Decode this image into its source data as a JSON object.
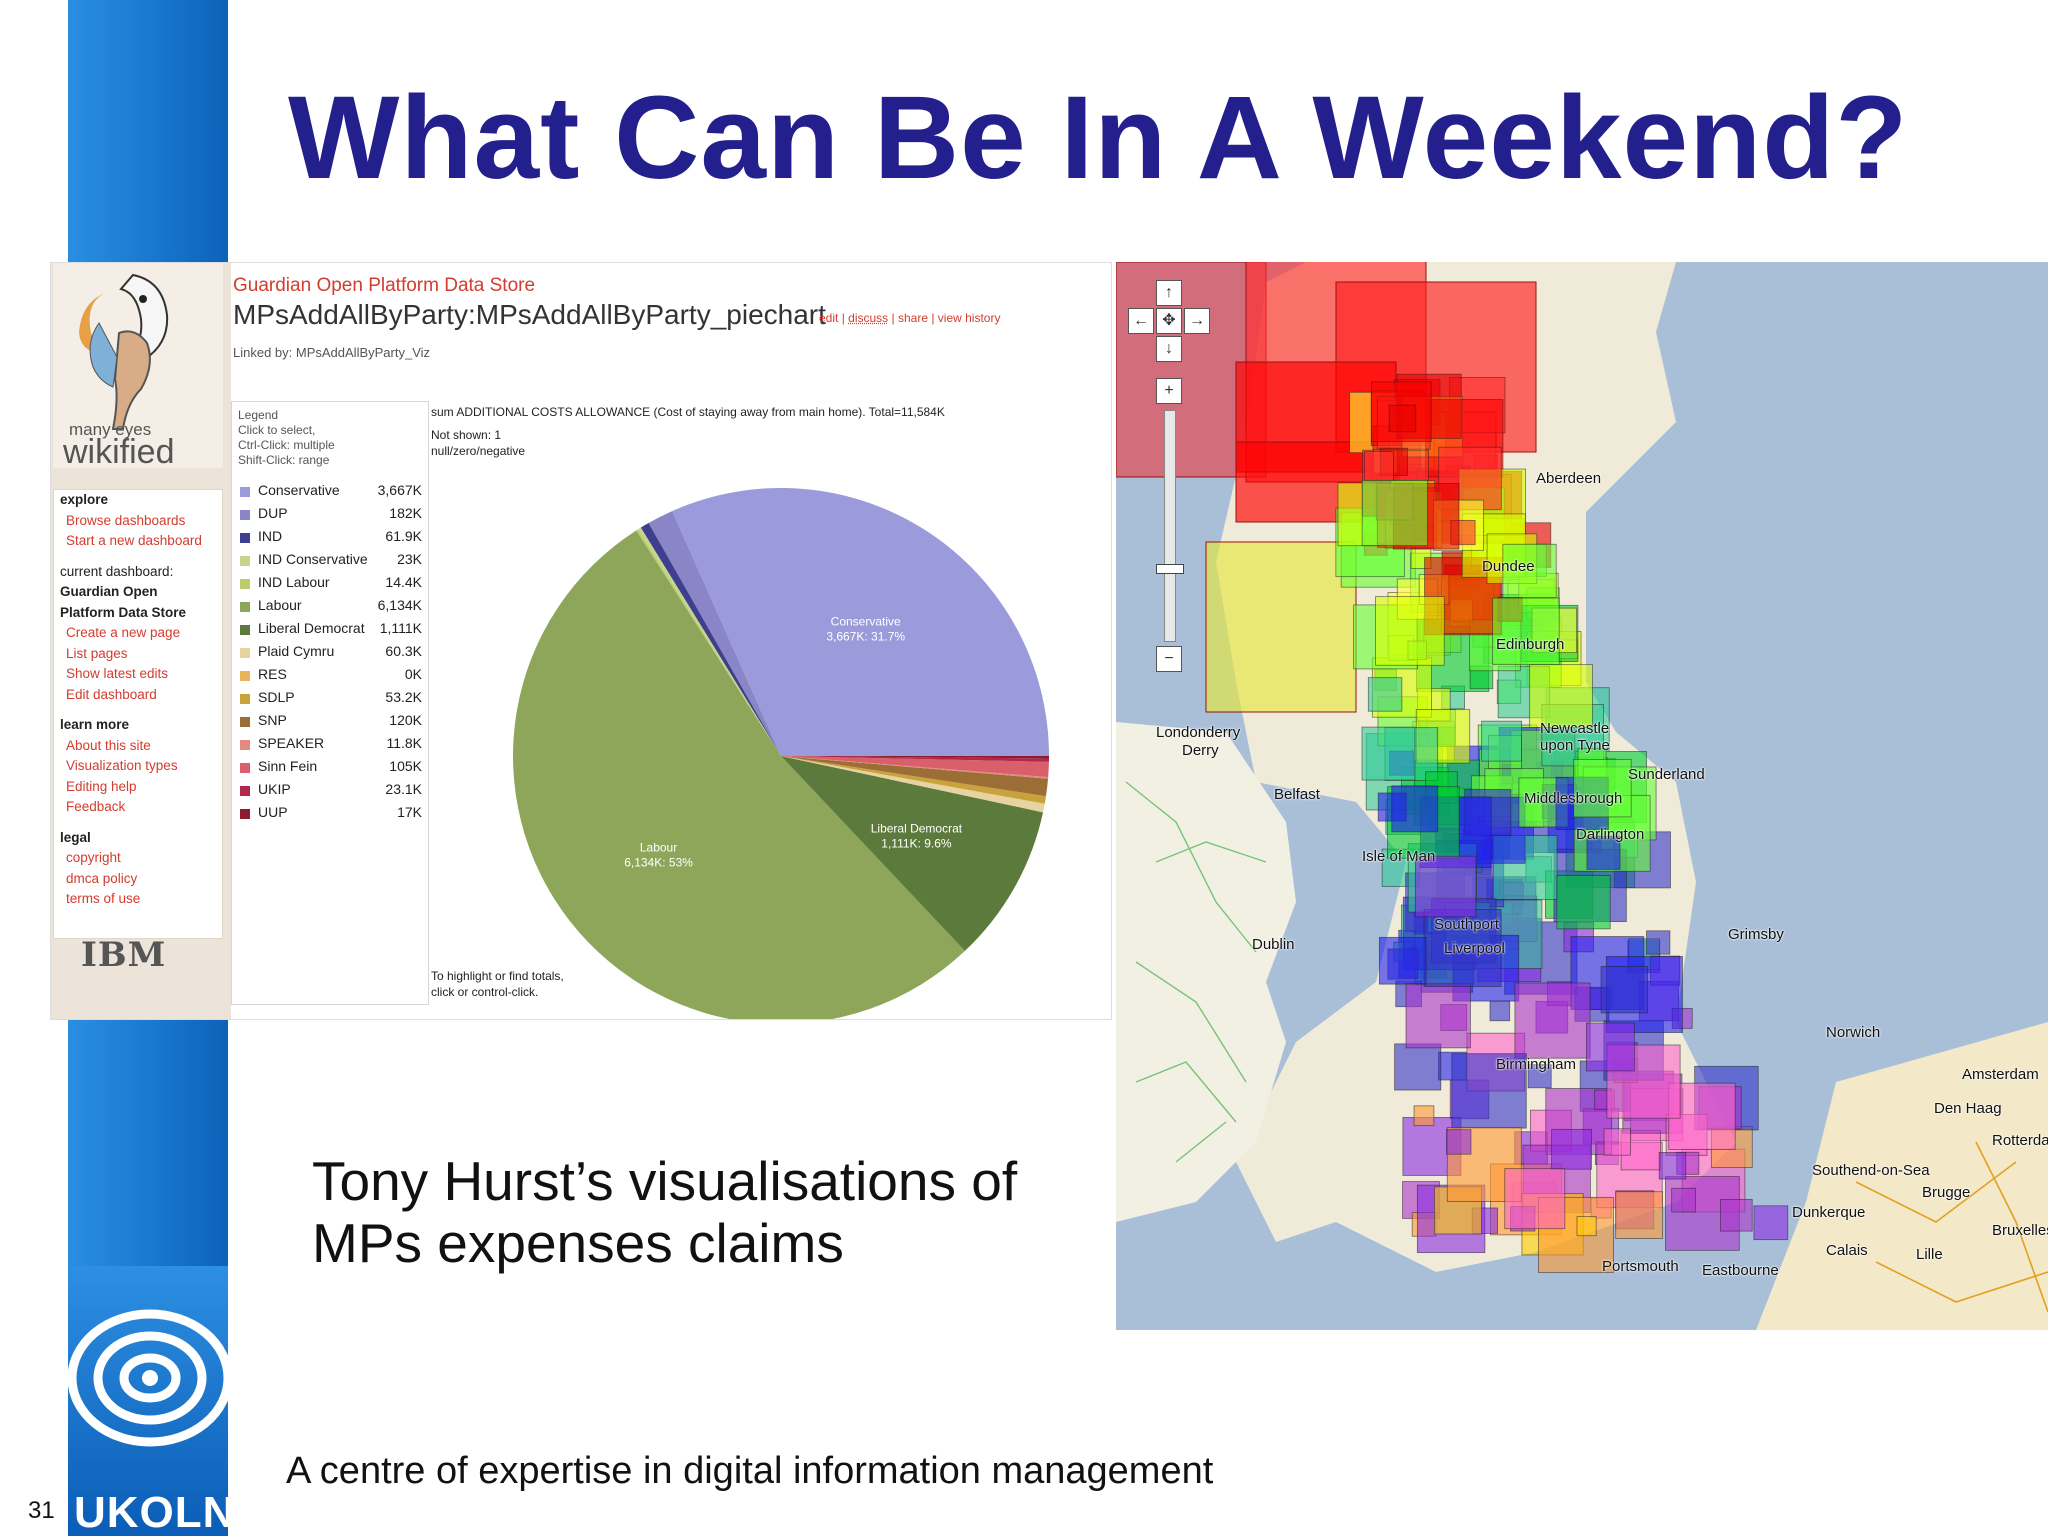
{
  "slide": {
    "title": "What Can Be In A Weekend?",
    "caption": "Tony Hurst’s visualisations of\nMPs expenses claims",
    "footer": "A centre of expertise in digital information management",
    "number": "31",
    "logo_text": "UKOLN"
  },
  "colors": {
    "title": "#231f8c",
    "bar": "#1877cf",
    "link": "#d33c2e"
  },
  "many_eyes": {
    "logo_line1": "many eyes",
    "logo_line2": "wikified",
    "menu": [
      {
        "kind": "h",
        "text": "explore"
      },
      {
        "kind": "l",
        "text": "Browse dashboards"
      },
      {
        "kind": "l",
        "text": "Start a new dashboard"
      },
      {
        "kind": "gap",
        "text": ""
      },
      {
        "kind": "t",
        "text": "current dashboard:"
      },
      {
        "kind": "h",
        "text": "Guardian Open"
      },
      {
        "kind": "h",
        "text": "Platform Data Store"
      },
      {
        "kind": "l",
        "text": "Create a new page"
      },
      {
        "kind": "l",
        "text": "List pages"
      },
      {
        "kind": "l",
        "text": "Show latest edits"
      },
      {
        "kind": "l",
        "text": "Edit dashboard"
      },
      {
        "kind": "gap",
        "text": ""
      },
      {
        "kind": "h",
        "text": "learn more"
      },
      {
        "kind": "l",
        "text": "About this site"
      },
      {
        "kind": "l",
        "text": "Visualization types"
      },
      {
        "kind": "l",
        "text": "Editing help"
      },
      {
        "kind": "l",
        "text": "Feedback"
      },
      {
        "kind": "gap",
        "text": ""
      },
      {
        "kind": "h",
        "text": "legal"
      },
      {
        "kind": "l",
        "text": "copyright"
      },
      {
        "kind": "l",
        "text": "dmca policy"
      },
      {
        "kind": "l",
        "text": "terms of use"
      }
    ],
    "ibm": "IBM",
    "datastore_title": "Guardian Open Platform Data Store",
    "page_name": "MPsAddAllByParty:MPsAddAllByParty_piechart",
    "page_links": [
      "edit",
      "discuss",
      "share",
      "view history"
    ],
    "linked_by": "Linked by: MPsAddAllByParty_Viz",
    "legend_header": "Legend\nClick to select,\nCtrl-Click: multiple\nShift-Click: range",
    "sum_text": "sum  ADDITIONAL COSTS ALLOWANCE (Cost of staying away from main home). Total=11,584K",
    "not_shown": "Not shown: 1\nnull/zero/negative",
    "hint": "To highlight or find totals,\nclick or control-click."
  },
  "chart_data": {
    "type": "pie",
    "title": "sum  ADDITIONAL COSTS ALLOWANCE (Cost of staying away from main home). Total=11,584K",
    "total": "11,584K",
    "legend_placement": "left",
    "series": [
      {
        "name": "Conservative",
        "value": 3667,
        "label": "3,667K",
        "color": "#9b9bdb",
        "slice_label": "Conservative\n3,667K: 31.7%"
      },
      {
        "name": "DUP",
        "value": 182,
        "label": "182K",
        "color": "#8a85c7",
        "slice_label": ""
      },
      {
        "name": "IND",
        "value": 61.9,
        "label": "61.9K",
        "color": "#3f3f8f",
        "slice_label": ""
      },
      {
        "name": "IND Conservative",
        "value": 23,
        "label": "23K",
        "color": "#c7d48a",
        "slice_label": ""
      },
      {
        "name": "IND Labour",
        "value": 14.4,
        "label": "14.4K",
        "color": "#b9cc6e",
        "slice_label": ""
      },
      {
        "name": "Labour",
        "value": 6134,
        "label": "6,134K",
        "color": "#8ea65a",
        "slice_label": "Labour\n6,134K: 53%"
      },
      {
        "name": "Liberal Democrat",
        "value": 1111,
        "label": "1,111K",
        "color": "#5c7a3c",
        "slice_label": "Liberal Democrat\n1,111K: 9.6%"
      },
      {
        "name": "Plaid Cymru",
        "value": 60.3,
        "label": "60.3K",
        "color": "#e5d3a0",
        "slice_label": ""
      },
      {
        "name": "RES",
        "value": 0.01,
        "label": "0K",
        "color": "#e8b35a",
        "slice_label": ""
      },
      {
        "name": "SDLP",
        "value": 53.2,
        "label": "53.2K",
        "color": "#c9a23c",
        "slice_label": ""
      },
      {
        "name": "SNP",
        "value": 120,
        "label": "120K",
        "color": "#9b6e35",
        "slice_label": ""
      },
      {
        "name": "SPEAKER",
        "value": 11.8,
        "label": "11.8K",
        "color": "#e08a80",
        "slice_label": ""
      },
      {
        "name": "Sinn Fein",
        "value": 105,
        "label": "105K",
        "color": "#d9606a",
        "slice_label": ""
      },
      {
        "name": "UKIP",
        "value": 23.1,
        "label": "23.1K",
        "color": "#b0284a",
        "slice_label": ""
      },
      {
        "name": "UUP",
        "value": 17,
        "label": "17K",
        "color": "#8c1b2e",
        "slice_label": ""
      }
    ]
  },
  "map": {
    "nav_icons": [
      "arrow-up-icon",
      "arrow-left-icon",
      "center-icon",
      "arrow-right-icon",
      "arrow-down-icon",
      "zoom-in-icon",
      "zoom-out-icon"
    ],
    "places": [
      "Aberdeen",
      "Dundee",
      "Edinburgh",
      "Londonderry",
      "Derry",
      "Belfast",
      "Newcastle upon Tyne",
      "Sunderland",
      "Middlesbrough",
      "Darlington",
      "Isle of Man",
      "Southport",
      "Liverpool",
      "Grimsby",
      "Dublin",
      "Birmingham",
      "Norwich",
      "Southend-on-Sea",
      "Portsmouth",
      "Eastbourne",
      "Dunkerque",
      "Calais",
      "Lille",
      "Brugge",
      "Amsterdam",
      "Den Haag",
      "Rotterdam",
      "Bruxelles"
    ]
  }
}
